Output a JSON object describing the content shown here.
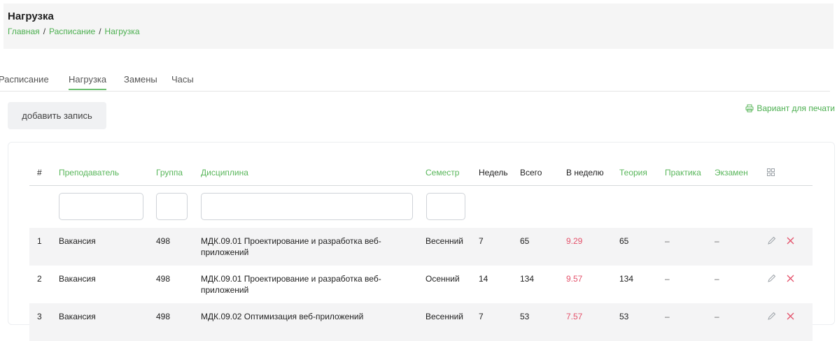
{
  "header": {
    "title": "Нагрузка",
    "breadcrumb": [
      "Главная",
      "Расписание",
      "Нагрузка"
    ]
  },
  "tabs": [
    {
      "label": "Расписание"
    },
    {
      "label": "Нагрузка",
      "active": true
    },
    {
      "label": "Замены"
    },
    {
      "label": "Часы"
    }
  ],
  "toolbar": {
    "add_label": "добавить запись",
    "print_label": "Вариант для печати"
  },
  "table": {
    "columns": [
      "#",
      "Преподаватель",
      "Группа",
      "Дисциплина",
      "Семестр",
      "Недель",
      "Всего",
      "В неделю",
      "Теория",
      "Практика",
      "Экзамен"
    ],
    "rows": [
      {
        "n": "1",
        "teacher": "Вакансия",
        "group": "498",
        "disc1": "МДК.09.01 Проектирование и разработка веб-",
        "disc2": "приложений",
        "semester": "Весенний",
        "weeks": "7",
        "total": "65",
        "per_week": "9.29",
        "theory": "65",
        "practice": "–",
        "exam": "–"
      },
      {
        "n": "2",
        "teacher": "Вакансия",
        "group": "498",
        "disc1": "МДК.09.01 Проектирование и разработка веб-",
        "disc2": "приложений",
        "semester": "Осенний",
        "weeks": "14",
        "total": "134",
        "per_week": "9.57",
        "theory": "134",
        "practice": "–",
        "exam": "–"
      },
      {
        "n": "3",
        "teacher": "Вакансия",
        "group": "498",
        "disc1": "МДК.09.02 Оптимизация веб-приложений",
        "disc2": "",
        "semester": "Весенний",
        "weeks": "7",
        "total": "53",
        "per_week": "7.57",
        "theory": "53",
        "practice": "–",
        "exam": "–"
      }
    ]
  },
  "colors": {
    "accent": "#58b65a",
    "highlight": "#e4526b"
  }
}
